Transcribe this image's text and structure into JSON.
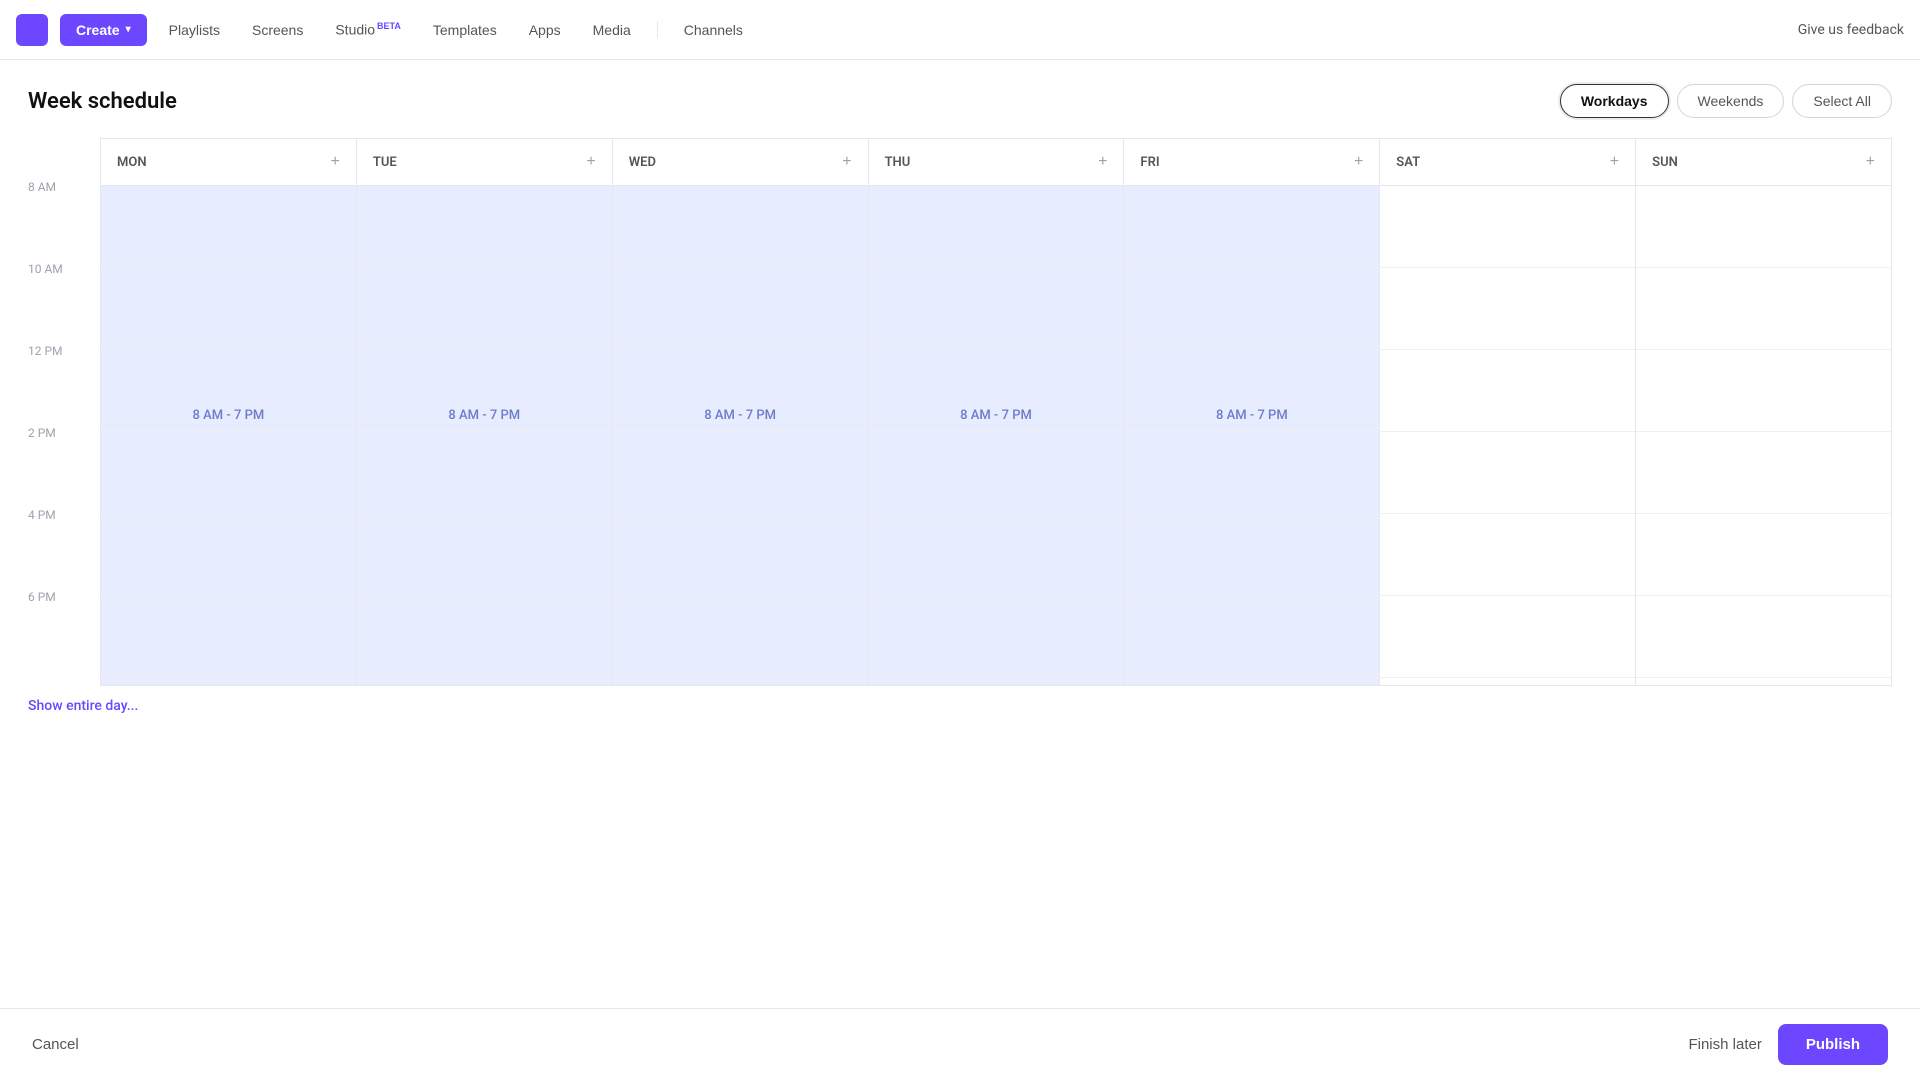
{
  "nav": {
    "create_label": "Create",
    "links": [
      {
        "id": "playlists",
        "label": "Playlists",
        "beta": false
      },
      {
        "id": "screens",
        "label": "Screens",
        "beta": false
      },
      {
        "id": "studio",
        "label": "Studio",
        "beta": true
      },
      {
        "id": "templates",
        "label": "Templates",
        "beta": false
      },
      {
        "id": "apps",
        "label": "Apps",
        "beta": false
      },
      {
        "id": "media",
        "label": "Media",
        "beta": false
      },
      {
        "id": "channels",
        "label": "Channels",
        "beta": false
      }
    ],
    "feedback_label": "Give us feedback"
  },
  "page": {
    "title": "Week schedule"
  },
  "day_filters": {
    "workdays": "Workdays",
    "weekends": "Weekends",
    "select_all": "Select All"
  },
  "days": [
    {
      "id": "mon",
      "label": "MON",
      "active": true
    },
    {
      "id": "tue",
      "label": "TUE",
      "active": true
    },
    {
      "id": "wed",
      "label": "WED",
      "active": true
    },
    {
      "id": "thu",
      "label": "THU",
      "active": true
    },
    {
      "id": "fri",
      "label": "FRI",
      "active": true
    },
    {
      "id": "sat",
      "label": "SAT",
      "active": false
    },
    {
      "id": "sun",
      "label": "SUN",
      "active": false
    }
  ],
  "time_labels": [
    "8 AM",
    "10 AM",
    "12 PM",
    "2 PM",
    "4 PM",
    "6 PM"
  ],
  "schedule_time": "8 AM - 7 PM",
  "show_entire_day": "Show entire day...",
  "bottom_bar": {
    "cancel": "Cancel",
    "finish_later": "Finish later",
    "publish": "Publish"
  }
}
